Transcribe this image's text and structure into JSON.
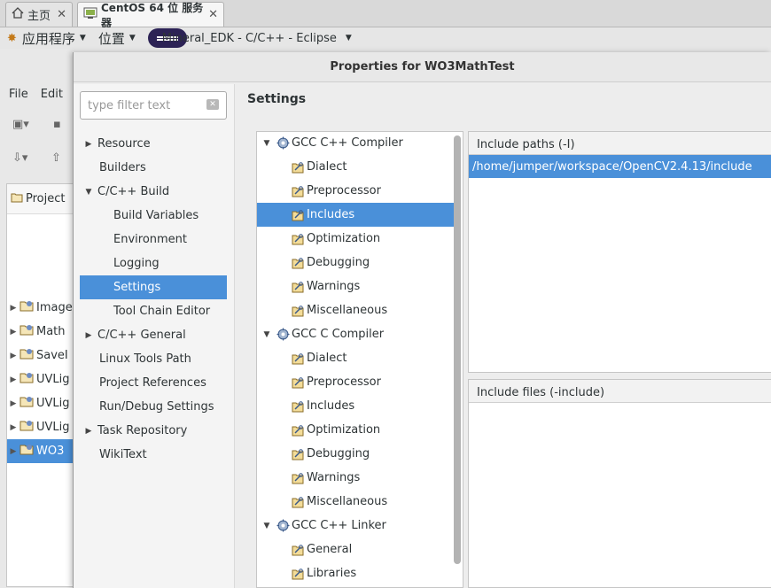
{
  "browser_tabs": [
    {
      "label": "主页"
    },
    {
      "label": "CentOS 64 位 服务器"
    }
  ],
  "panel": {
    "apps": "应用程序",
    "places": "位置",
    "window_title": "Mineral_EDK - C/C++ - Eclipse"
  },
  "eclipse": {
    "menu": [
      "File",
      "Edit"
    ],
    "explorer_title": "Project",
    "projects": [
      "Image",
      "Math",
      "SaveI",
      "UVLig",
      "UVLig",
      "UVLig",
      "WO3"
    ]
  },
  "dialog": {
    "title": "Properties for WO3MathTest",
    "filter_placeholder": "type filter text",
    "page_title": "Settings",
    "nav": [
      {
        "label": "Resource",
        "toggle": "▶",
        "indent": 0
      },
      {
        "label": "Builders",
        "toggle": "",
        "indent": 0
      },
      {
        "label": "C/C++ Build",
        "toggle": "▼",
        "indent": 0
      },
      {
        "label": "Build Variables",
        "toggle": "",
        "indent": 1
      },
      {
        "label": "Environment",
        "toggle": "",
        "indent": 1
      },
      {
        "label": "Logging",
        "toggle": "",
        "indent": 1
      },
      {
        "label": "Settings",
        "toggle": "",
        "indent": 1,
        "selected": true
      },
      {
        "label": "Tool Chain Editor",
        "toggle": "",
        "indent": 1
      },
      {
        "label": "C/C++ General",
        "toggle": "▶",
        "indent": 0
      },
      {
        "label": "Linux Tools Path",
        "toggle": "",
        "indent": 0
      },
      {
        "label": "Project References",
        "toggle": "",
        "indent": 0
      },
      {
        "label": "Run/Debug Settings",
        "toggle": "",
        "indent": 0
      },
      {
        "label": "Task Repository",
        "toggle": "▶",
        "indent": 0
      },
      {
        "label": "WikiText",
        "toggle": "",
        "indent": 0
      }
    ],
    "tool_tree": [
      {
        "label": "GCC C++ Compiler",
        "type": "group"
      },
      {
        "label": "Dialect",
        "type": "item"
      },
      {
        "label": "Preprocessor",
        "type": "item"
      },
      {
        "label": "Includes",
        "type": "item",
        "selected": true
      },
      {
        "label": "Optimization",
        "type": "item"
      },
      {
        "label": "Debugging",
        "type": "item"
      },
      {
        "label": "Warnings",
        "type": "item"
      },
      {
        "label": "Miscellaneous",
        "type": "item"
      },
      {
        "label": "GCC C Compiler",
        "type": "group"
      },
      {
        "label": "Dialect",
        "type": "item"
      },
      {
        "label": "Preprocessor",
        "type": "item"
      },
      {
        "label": "Includes",
        "type": "item"
      },
      {
        "label": "Optimization",
        "type": "item"
      },
      {
        "label": "Debugging",
        "type": "item"
      },
      {
        "label": "Warnings",
        "type": "item"
      },
      {
        "label": "Miscellaneous",
        "type": "item"
      },
      {
        "label": "GCC C++ Linker",
        "type": "group"
      },
      {
        "label": "General",
        "type": "item"
      },
      {
        "label": "Libraries",
        "type": "item"
      }
    ],
    "include_paths": {
      "label": "Include paths (-I)",
      "entries": [
        "/home/jumper/workspace/OpenCV2.4.13/include"
      ]
    },
    "include_files": {
      "label": "Include files (-include)",
      "entries": []
    }
  },
  "colors": {
    "selection": "#4a90d9",
    "background": "#ededed"
  }
}
